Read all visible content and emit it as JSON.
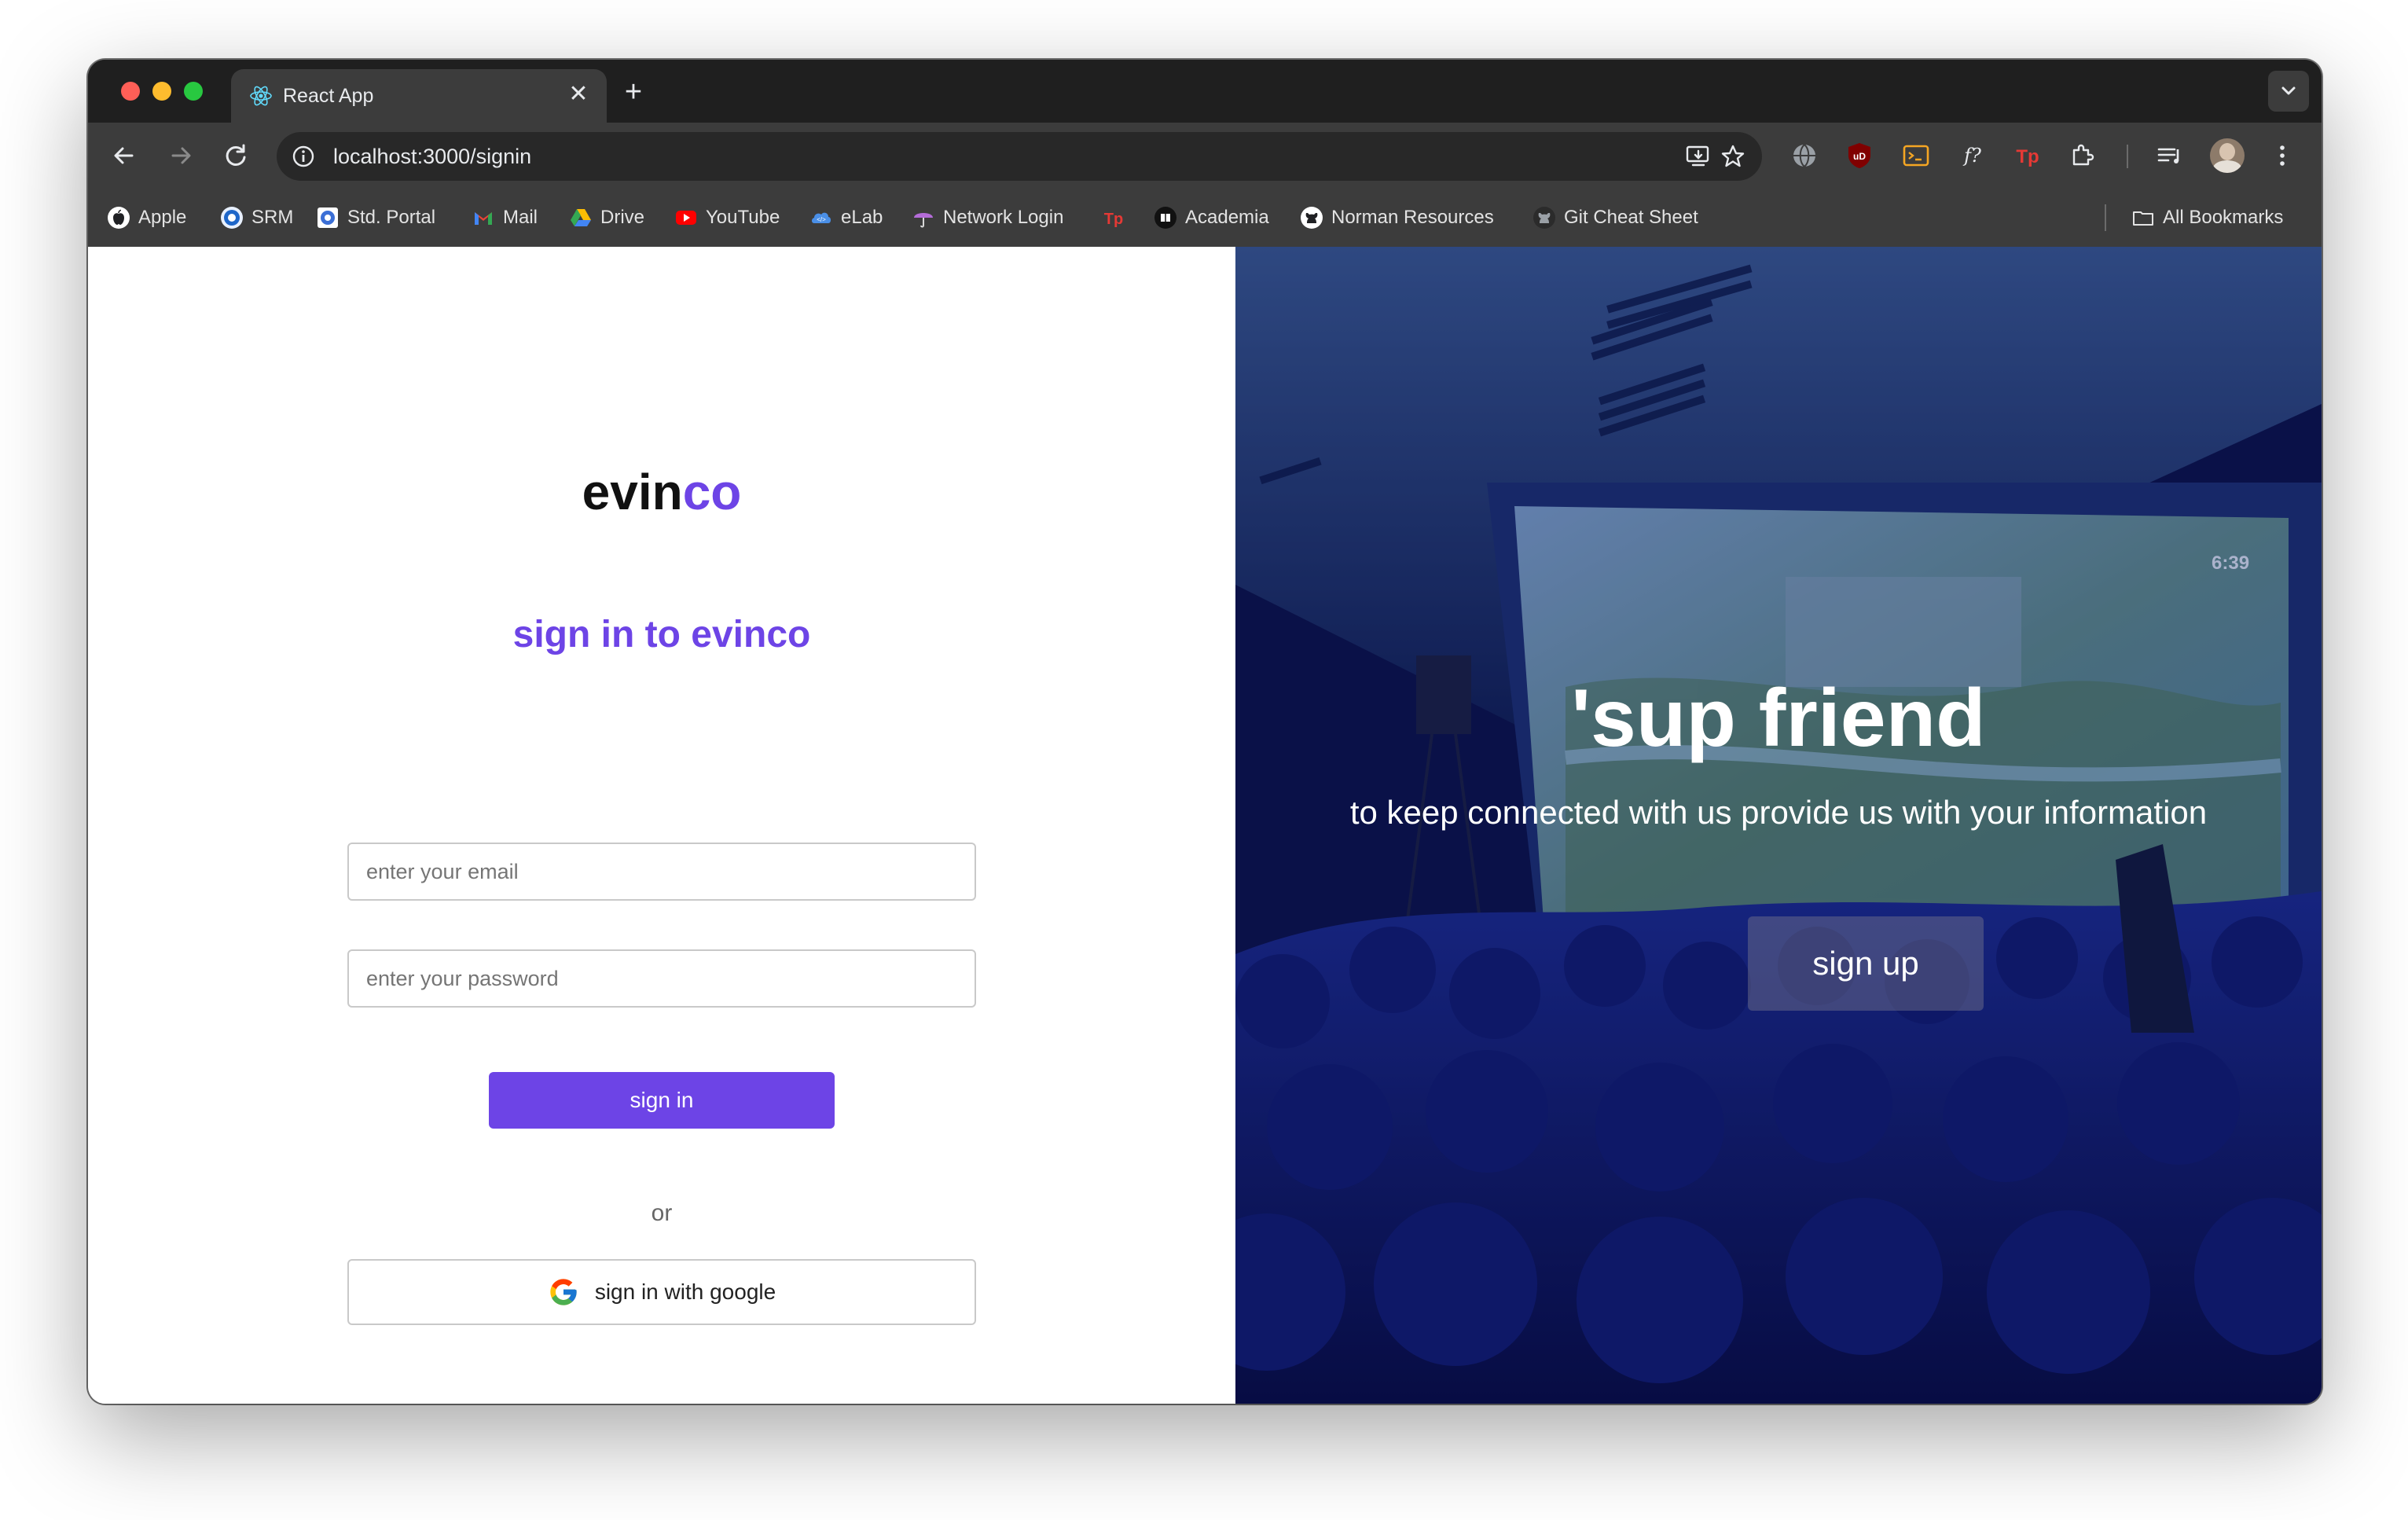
{
  "browser": {
    "tab": {
      "title": "React App",
      "favicon": "react-icon"
    },
    "address": {
      "url": "localhost:3000/signin"
    },
    "bookmarks": [
      {
        "label": "Apple",
        "icon": "apple-icon"
      },
      {
        "label": "SRM",
        "icon": "srm-icon"
      },
      {
        "label": "Std. Portal",
        "icon": "portal-icon"
      },
      {
        "label": "Mail",
        "icon": "gmail-icon"
      },
      {
        "label": "Drive",
        "icon": "drive-icon"
      },
      {
        "label": "YouTube",
        "icon": "youtube-icon"
      },
      {
        "label": "eLab",
        "icon": "elab-icon"
      },
      {
        "label": "Network Login",
        "icon": "umbrella-icon"
      },
      {
        "label": "",
        "icon": "tp-icon"
      },
      {
        "label": "Academia",
        "icon": "academia-icon"
      },
      {
        "label": "Norman Resources",
        "icon": "github-icon"
      },
      {
        "label": "Git Cheat Sheet",
        "icon": "github-icon"
      }
    ],
    "all_bookmarks": "All Bookmarks"
  },
  "signin": {
    "logo_part1": "evin",
    "logo_part2": "co",
    "heading": "sign in to evinco",
    "email_placeholder": "enter your email",
    "password_placeholder": "enter your password",
    "signin_button": "sign in",
    "or_text": "or",
    "google_button": "sign in with google"
  },
  "hero": {
    "title": "'sup friend",
    "subtitle": "to keep connected with us provide us with your information",
    "signup_button": "sign up"
  },
  "colors": {
    "accent": "#6d44e6",
    "hero_overlay": "#0b1460"
  }
}
